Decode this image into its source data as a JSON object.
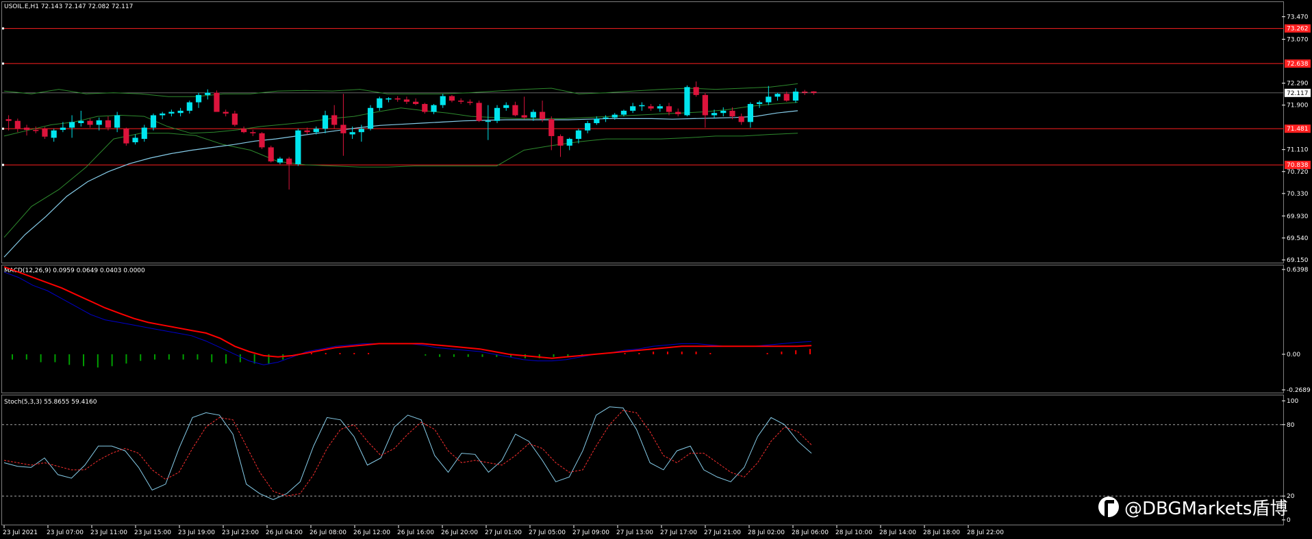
{
  "header": {
    "main_title": "USOIL.E,H1  72.143 72.147 72.082 72.117",
    "macd_title": "MACD(12,26,9) 0.0959 0.0649 0.0403 0.0000",
    "stoch_title": "Stoch(5,3,3) 55.8655 59.4160"
  },
  "watermark": {
    "text": "@DBGMarkets盾博",
    "icon": "weibo-logo-icon"
  },
  "colors": {
    "bull": "#00e5ee",
    "bear": "#dc143c",
    "bollinger": "#2e8b2e",
    "ma": "#87ceeb",
    "hline": "#ff2020",
    "macd_main": "#0000cd",
    "macd_signal": "#ff0000",
    "hist_pos": "#ff0000",
    "hist_neg": "#00a000",
    "stoch_main": "#87ceeb",
    "stoch_signal": "#ff3030",
    "grid": "#7f7f7f"
  },
  "chart_data": [
    {
      "type": "candlestick",
      "title": "USOIL.E,H1",
      "ylim": [
        69.15,
        73.67
      ],
      "y_ticks": [
        "73.470",
        "73.070",
        "72.290",
        "71.900",
        "71.110",
        "70.720",
        "70.330",
        "69.930",
        "69.540",
        "69.150"
      ],
      "price_boxes": [
        {
          "label": "73.262",
          "value": 73.262
        },
        {
          "label": "72.638",
          "value": 72.638
        },
        {
          "label": "72.117",
          "value": 72.117
        },
        {
          "label": "71.481",
          "value": 71.481
        },
        {
          "label": "70.838",
          "value": 70.838
        }
      ],
      "horizontal_lines": [
        73.262,
        72.638,
        71.481,
        70.838
      ],
      "current_price": 72.117,
      "x_labels": [
        "23 Jul 2021",
        "23 Jul 07:00",
        "23 Jul 11:00",
        "23 Jul 15:00",
        "23 Jul 19:00",
        "23 Jul 23:00",
        "26 Jul 04:00",
        "26 Jul 08:00",
        "26 Jul 12:00",
        "26 Jul 16:00",
        "26 Jul 20:00",
        "27 Jul 01:00",
        "27 Jul 05:00",
        "27 Jul 09:00",
        "27 Jul 13:00",
        "27 Jul 17:00",
        "27 Jul 21:00",
        "28 Jul 02:00",
        "28 Jul 06:00",
        "28 Jul 10:00",
        "28 Jul 14:00",
        "28 Jul 18:00",
        "28 Jul 22:00"
      ],
      "candles": [
        {
          "o": 71.65,
          "h": 71.72,
          "l": 71.45,
          "c": 71.62
        },
        {
          "o": 71.62,
          "h": 71.66,
          "l": 71.42,
          "c": 71.48
        },
        {
          "o": 71.5,
          "h": 71.55,
          "l": 71.36,
          "c": 71.46
        },
        {
          "o": 71.46,
          "h": 71.52,
          "l": 71.4,
          "c": 71.44
        },
        {
          "o": 71.48,
          "h": 71.51,
          "l": 71.3,
          "c": 71.34
        },
        {
          "o": 71.32,
          "h": 71.48,
          "l": 71.25,
          "c": 71.45
        },
        {
          "o": 71.46,
          "h": 71.6,
          "l": 71.42,
          "c": 71.5
        },
        {
          "o": 71.5,
          "h": 71.72,
          "l": 71.32,
          "c": 71.6
        },
        {
          "o": 71.58,
          "h": 71.8,
          "l": 71.52,
          "c": 71.62
        },
        {
          "o": 71.62,
          "h": 71.66,
          "l": 71.5,
          "c": 71.55
        },
        {
          "o": 71.55,
          "h": 71.68,
          "l": 71.45,
          "c": 71.63
        },
        {
          "o": 71.63,
          "h": 71.7,
          "l": 71.45,
          "c": 71.5
        },
        {
          "o": 71.5,
          "h": 71.78,
          "l": 71.42,
          "c": 71.72
        },
        {
          "o": 71.48,
          "h": 71.5,
          "l": 71.18,
          "c": 71.22
        },
        {
          "o": 71.24,
          "h": 71.38,
          "l": 71.2,
          "c": 71.32
        },
        {
          "o": 71.3,
          "h": 71.55,
          "l": 71.25,
          "c": 71.5
        },
        {
          "o": 71.5,
          "h": 71.75,
          "l": 71.45,
          "c": 71.72
        },
        {
          "o": 71.72,
          "h": 71.78,
          "l": 71.65,
          "c": 71.75
        },
        {
          "o": 71.75,
          "h": 71.82,
          "l": 71.7,
          "c": 71.78
        },
        {
          "o": 71.76,
          "h": 71.85,
          "l": 71.7,
          "c": 71.8
        },
        {
          "o": 71.8,
          "h": 71.98,
          "l": 71.75,
          "c": 71.95
        },
        {
          "o": 71.95,
          "h": 72.12,
          "l": 71.85,
          "c": 72.08
        },
        {
          "o": 72.08,
          "h": 72.18,
          "l": 72.0,
          "c": 72.12
        },
        {
          "o": 72.12,
          "h": 72.16,
          "l": 71.8,
          "c": 71.78
        },
        {
          "o": 71.78,
          "h": 71.82,
          "l": 71.7,
          "c": 71.75
        },
        {
          "o": 71.75,
          "h": 71.8,
          "l": 71.52,
          "c": 71.55
        },
        {
          "o": 71.48,
          "h": 71.52,
          "l": 71.4,
          "c": 71.42
        },
        {
          "o": 71.42,
          "h": 71.46,
          "l": 71.35,
          "c": 71.4
        },
        {
          "o": 71.4,
          "h": 71.42,
          "l": 71.12,
          "c": 71.15
        },
        {
          "o": 71.15,
          "h": 71.18,
          "l": 70.88,
          "c": 70.9
        },
        {
          "o": 70.88,
          "h": 70.98,
          "l": 70.85,
          "c": 70.95
        },
        {
          "o": 70.95,
          "h": 70.98,
          "l": 70.4,
          "c": 70.85
        },
        {
          "o": 70.85,
          "h": 71.48,
          "l": 70.82,
          "c": 71.45
        },
        {
          "o": 71.45,
          "h": 71.5,
          "l": 71.38,
          "c": 71.42
        },
        {
          "o": 71.42,
          "h": 71.52,
          "l": 71.38,
          "c": 71.48
        },
        {
          "o": 71.48,
          "h": 71.8,
          "l": 71.4,
          "c": 71.72
        },
        {
          "o": 71.72,
          "h": 71.9,
          "l": 71.48,
          "c": 71.55
        },
        {
          "o": 71.55,
          "h": 72.1,
          "l": 71.0,
          "c": 71.4
        },
        {
          "o": 71.38,
          "h": 71.52,
          "l": 71.3,
          "c": 71.42
        },
        {
          "o": 71.42,
          "h": 71.55,
          "l": 71.25,
          "c": 71.48
        },
        {
          "o": 71.48,
          "h": 71.9,
          "l": 71.45,
          "c": 71.85
        },
        {
          "o": 71.85,
          "h": 72.05,
          "l": 71.8,
          "c": 72.02
        },
        {
          "o": 72.0,
          "h": 72.04,
          "l": 71.95,
          "c": 72.02
        },
        {
          "o": 72.02,
          "h": 72.06,
          "l": 71.96,
          "c": 72.0
        },
        {
          "o": 72.0,
          "h": 72.05,
          "l": 71.92,
          "c": 71.96
        },
        {
          "o": 71.96,
          "h": 72.02,
          "l": 71.9,
          "c": 71.92
        },
        {
          "o": 71.92,
          "h": 71.94,
          "l": 71.75,
          "c": 71.78
        },
        {
          "o": 71.78,
          "h": 71.92,
          "l": 71.74,
          "c": 71.9
        },
        {
          "o": 71.9,
          "h": 72.1,
          "l": 71.85,
          "c": 72.06
        },
        {
          "o": 72.06,
          "h": 72.08,
          "l": 71.95,
          "c": 71.98
        },
        {
          "o": 71.98,
          "h": 72.02,
          "l": 71.92,
          "c": 71.96
        },
        {
          "o": 71.96,
          "h": 72.0,
          "l": 71.9,
          "c": 71.94
        },
        {
          "o": 71.94,
          "h": 71.98,
          "l": 71.6,
          "c": 71.62
        },
        {
          "o": 71.62,
          "h": 71.9,
          "l": 71.28,
          "c": 71.62
        },
        {
          "o": 71.62,
          "h": 71.9,
          "l": 71.58,
          "c": 71.85
        },
        {
          "o": 71.85,
          "h": 71.95,
          "l": 71.8,
          "c": 71.9
        },
        {
          "o": 71.9,
          "h": 71.96,
          "l": 71.7,
          "c": 71.72
        },
        {
          "o": 71.72,
          "h": 72.05,
          "l": 71.65,
          "c": 71.68
        },
        {
          "o": 71.68,
          "h": 71.82,
          "l": 71.62,
          "c": 71.78
        },
        {
          "o": 71.78,
          "h": 71.98,
          "l": 71.6,
          "c": 71.65
        },
        {
          "o": 71.65,
          "h": 71.7,
          "l": 71.1,
          "c": 71.35
        },
        {
          "o": 71.35,
          "h": 71.38,
          "l": 70.98,
          "c": 71.18
        },
        {
          "o": 71.18,
          "h": 71.32,
          "l": 71.1,
          "c": 71.3
        },
        {
          "o": 71.3,
          "h": 71.48,
          "l": 71.22,
          "c": 71.45
        },
        {
          "o": 71.45,
          "h": 71.62,
          "l": 71.4,
          "c": 71.58
        },
        {
          "o": 71.58,
          "h": 71.7,
          "l": 71.55,
          "c": 71.66
        },
        {
          "o": 71.66,
          "h": 71.72,
          "l": 71.6,
          "c": 71.68
        },
        {
          "o": 71.68,
          "h": 71.76,
          "l": 71.64,
          "c": 71.73
        },
        {
          "o": 71.73,
          "h": 71.82,
          "l": 71.7,
          "c": 71.8
        },
        {
          "o": 71.8,
          "h": 71.94,
          "l": 71.76,
          "c": 71.88
        },
        {
          "o": 71.88,
          "h": 71.95,
          "l": 71.8,
          "c": 71.9
        },
        {
          "o": 71.88,
          "h": 71.92,
          "l": 71.8,
          "c": 71.84
        },
        {
          "o": 71.84,
          "h": 71.92,
          "l": 71.78,
          "c": 71.88
        },
        {
          "o": 71.88,
          "h": 71.94,
          "l": 71.72,
          "c": 71.78
        },
        {
          "o": 71.78,
          "h": 71.84,
          "l": 71.7,
          "c": 71.74
        },
        {
          "o": 71.72,
          "h": 72.25,
          "l": 71.7,
          "c": 72.22
        },
        {
          "o": 72.22,
          "h": 72.32,
          "l": 72.05,
          "c": 72.08
        },
        {
          "o": 72.08,
          "h": 72.12,
          "l": 71.5,
          "c": 71.72
        },
        {
          "o": 71.72,
          "h": 71.82,
          "l": 71.66,
          "c": 71.76
        },
        {
          "o": 71.76,
          "h": 71.86,
          "l": 71.7,
          "c": 71.8
        },
        {
          "o": 71.8,
          "h": 71.86,
          "l": 71.65,
          "c": 71.7
        },
        {
          "o": 71.7,
          "h": 71.75,
          "l": 71.55,
          "c": 71.6
        },
        {
          "o": 71.6,
          "h": 71.95,
          "l": 71.5,
          "c": 71.92
        },
        {
          "o": 71.92,
          "h": 71.98,
          "l": 71.85,
          "c": 71.95
        },
        {
          "o": 71.95,
          "h": 72.24,
          "l": 71.9,
          "c": 72.05
        },
        {
          "o": 72.05,
          "h": 72.12,
          "l": 71.98,
          "c": 72.1
        },
        {
          "o": 72.1,
          "h": 72.14,
          "l": 71.96,
          "c": 71.98
        },
        {
          "o": 71.98,
          "h": 72.2,
          "l": 71.94,
          "c": 72.14
        },
        {
          "o": 72.14,
          "h": 72.17,
          "l": 72.08,
          "c": 72.12
        },
        {
          "o": 72.143,
          "h": 72.147,
          "l": 72.082,
          "c": 72.117
        }
      ],
      "ma": [
        69.2,
        69.6,
        69.92,
        70.28,
        70.54,
        70.72,
        70.86,
        70.96,
        71.04,
        71.1,
        71.15,
        71.2,
        71.26,
        71.3,
        71.35,
        71.4,
        71.45,
        71.5,
        71.54,
        71.56,
        71.58,
        71.6,
        71.62,
        71.63,
        71.64,
        71.64,
        71.64,
        71.64,
        71.65,
        71.66,
        71.66,
        71.66,
        71.65,
        71.66,
        71.67,
        71.68,
        71.7,
        71.76,
        71.8
      ],
      "bb_upper": [
        72.15,
        72.1,
        72.18,
        72.1,
        72.12,
        72.1,
        72.05,
        72.05,
        72.1,
        72.1,
        72.15,
        72.16,
        72.15,
        72.18,
        72.1,
        72.1,
        72.1,
        72.12,
        72.15,
        72.18,
        72.2,
        72.1,
        72.12,
        72.15,
        72.18,
        72.2,
        72.18,
        72.2,
        72.22,
        72.28
      ],
      "bb_lower": [
        69.55,
        70.1,
        70.4,
        70.8,
        71.3,
        71.4,
        71.4,
        71.36,
        71.2,
        71.1,
        70.9,
        70.84,
        70.82,
        70.8,
        70.8,
        70.82,
        70.82,
        70.82,
        70.82,
        71.1,
        71.18,
        71.25,
        71.3,
        71.3,
        71.3,
        71.32,
        71.35,
        71.35,
        71.38,
        71.4
      ],
      "bb_mid": [
        71.35,
        71.45,
        71.55,
        71.6,
        71.7,
        71.72,
        71.7,
        71.52,
        71.4,
        71.42,
        71.46,
        71.52,
        71.56,
        71.6,
        71.66,
        71.7,
        71.78,
        71.85,
        71.8,
        71.76,
        71.7,
        71.68,
        71.66,
        71.66,
        71.66,
        71.68,
        71.7,
        71.72,
        71.74,
        71.76,
        71.78,
        71.82,
        71.88,
        71.92,
        71.95
      ]
    },
    {
      "type": "line",
      "title": "MACD(12,26,9)",
      "ylim": [
        -0.2689,
        0.6398
      ],
      "y_ticks": [
        "0.6398",
        "0.00",
        "-0.2689"
      ],
      "series": [
        {
          "name": "MACD",
          "values": [
            0.62,
            0.58,
            0.52,
            0.48,
            0.42,
            0.36,
            0.3,
            0.26,
            0.24,
            0.22,
            0.2,
            0.18,
            0.16,
            0.14,
            0.1,
            0.05,
            0.0,
            -0.05,
            -0.08,
            -0.06,
            -0.02,
            0.02,
            0.04,
            0.06,
            0.07,
            0.08,
            0.08,
            0.08,
            0.08,
            0.07,
            0.05,
            0.04,
            0.03,
            0.02,
            0.0,
            -0.02,
            -0.04,
            -0.05,
            -0.05,
            -0.04,
            -0.02,
            0.0,
            0.01,
            0.03,
            0.04,
            0.06,
            0.07,
            0.08,
            0.08,
            0.07,
            0.06,
            0.06,
            0.06,
            0.07,
            0.08,
            0.09,
            0.096
          ]
        },
        {
          "name": "Signal",
          "values": [
            0.66,
            0.62,
            0.58,
            0.54,
            0.5,
            0.45,
            0.4,
            0.35,
            0.31,
            0.27,
            0.24,
            0.22,
            0.2,
            0.18,
            0.16,
            0.12,
            0.06,
            0.02,
            -0.01,
            -0.02,
            -0.01,
            0.01,
            0.03,
            0.05,
            0.06,
            0.07,
            0.08,
            0.08,
            0.08,
            0.08,
            0.07,
            0.06,
            0.05,
            0.04,
            0.02,
            0.0,
            -0.01,
            -0.02,
            -0.03,
            -0.02,
            -0.01,
            0.0,
            0.01,
            0.02,
            0.03,
            0.04,
            0.05,
            0.06,
            0.06,
            0.06,
            0.06,
            0.06,
            0.06,
            0.06,
            0.06,
            0.06,
            0.065
          ]
        },
        {
          "name": "OsMA",
          "values": [
            -0.04,
            -0.04,
            -0.06,
            -0.06,
            -0.08,
            -0.09,
            -0.1,
            -0.09,
            -0.07,
            -0.05,
            -0.04,
            -0.04,
            -0.04,
            -0.04,
            -0.06,
            -0.07,
            -0.06,
            -0.07,
            -0.07,
            -0.04,
            -0.01,
            0.01,
            0.01,
            0.01,
            0.01,
            0.01,
            0.0,
            0.0,
            0.0,
            -0.01,
            -0.02,
            -0.02,
            -0.02,
            -0.02,
            -0.02,
            -0.02,
            -0.03,
            -0.03,
            -0.02,
            -0.02,
            -0.01,
            0.0,
            0.0,
            0.01,
            0.01,
            0.02,
            0.02,
            0.02,
            0.02,
            0.01,
            0.0,
            0.0,
            0.0,
            0.01,
            0.02,
            0.03,
            0.04
          ]
        }
      ]
    },
    {
      "type": "line",
      "title": "Stoch(5,3,3)",
      "ylim": [
        0,
        100
      ],
      "y_ticks": [
        "100",
        "80",
        "20",
        "0"
      ],
      "levels": [
        80,
        20
      ],
      "series": [
        {
          "name": "Main",
          "values": [
            48,
            45,
            44,
            52,
            38,
            35,
            46,
            62,
            62,
            58,
            44,
            25,
            30,
            60,
            86,
            90,
            88,
            72,
            30,
            22,
            17,
            22,
            32,
            62,
            86,
            84,
            70,
            46,
            52,
            78,
            88,
            84,
            54,
            40,
            56,
            55,
            40,
            50,
            72,
            66,
            50,
            32,
            36,
            58,
            88,
            95,
            94,
            76,
            48,
            42,
            58,
            62,
            42,
            36,
            32,
            44,
            70,
            86,
            80,
            66,
            56
          ]
        },
        {
          "name": "Signal",
          "values": [
            50,
            48,
            46,
            48,
            45,
            42,
            42,
            50,
            56,
            60,
            56,
            42,
            34,
            40,
            60,
            78,
            86,
            84,
            62,
            40,
            24,
            20,
            22,
            38,
            60,
            76,
            80,
            66,
            54,
            60,
            72,
            82,
            76,
            58,
            48,
            50,
            48,
            46,
            54,
            64,
            60,
            48,
            40,
            42,
            62,
            80,
            92,
            90,
            74,
            54,
            48,
            56,
            56,
            48,
            40,
            36,
            48,
            66,
            78,
            74,
            63
          ]
        }
      ]
    }
  ]
}
